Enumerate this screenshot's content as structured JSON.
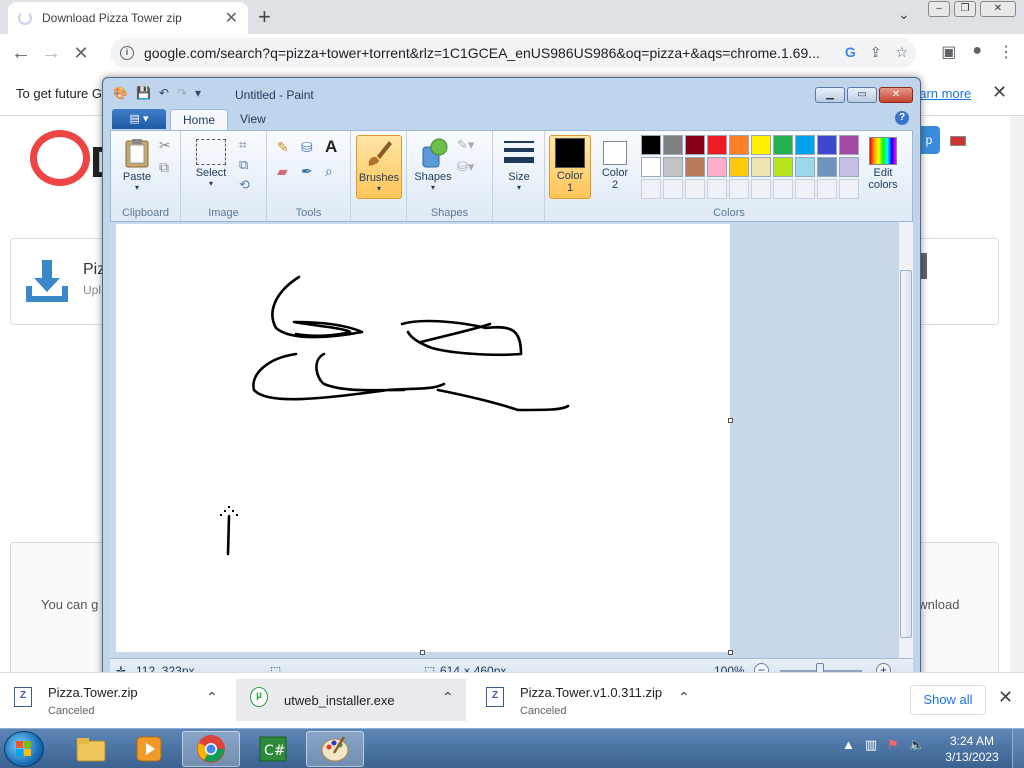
{
  "browser": {
    "tab_title": "Download Pizza Tower zip",
    "url": "google.com/search?q=pizza+tower+torrent&rlz=1C1GCEA_enUS986US986&oq=pizza+&aqs=chrome.1.69...",
    "infobar_text": "To get future G",
    "infobar_link": "earn more"
  },
  "page": {
    "card_title": "Piz",
    "card_sub": "Upl",
    "bottom_left": "You can g",
    "bottom_right": "ownload",
    "side_button": "p"
  },
  "paint": {
    "title": "Untitled - Paint",
    "tabs": {
      "file": "▤ ▾",
      "home": "Home",
      "view": "View"
    },
    "groups": {
      "clipboard": "Clipboard",
      "image": "Image",
      "tools": "Tools",
      "shapes": "Shapes",
      "colors": "Colors"
    },
    "buttons": {
      "paste": "Paste",
      "select": "Select",
      "brushes": "Brushes",
      "shapes": "Shapes",
      "size": "Size",
      "color1": "Color\n1",
      "color1_a": "Color",
      "color1_b": "1",
      "color2_a": "Color",
      "color2_b": "2",
      "edit_colors_a": "Edit",
      "edit_colors_b": "colors"
    },
    "palette_row1": [
      "#000000",
      "#7f7f7f",
      "#880015",
      "#ed1c24",
      "#ff7f27",
      "#fff200",
      "#22b14c",
      "#00a2e8",
      "#3f48cc",
      "#a349a4"
    ],
    "palette_row2": [
      "#ffffff",
      "#c3c3c3",
      "#b97a57",
      "#ffaec9",
      "#ffc90e",
      "#efe4b0",
      "#b5e61d",
      "#99d9ea",
      "#7092be",
      "#c8bfe7"
    ],
    "color1_value": "#000000",
    "color2_value": "#ffffff",
    "status": {
      "cursor_pos": "112, 323px",
      "canvas_size": "614 × 460px",
      "zoom": "100%"
    }
  },
  "downloads": {
    "items": [
      {
        "name": "Pizza.Tower.zip",
        "status": "Canceled"
      },
      {
        "name": "utweb_installer.exe",
        "status": ""
      },
      {
        "name": "Pizza.Tower.v1.0.311.zip",
        "status": "Canceled"
      }
    ],
    "show_all": "Show all"
  },
  "taskbar": {
    "time": "3:24 AM",
    "date": "3/13/2023"
  }
}
